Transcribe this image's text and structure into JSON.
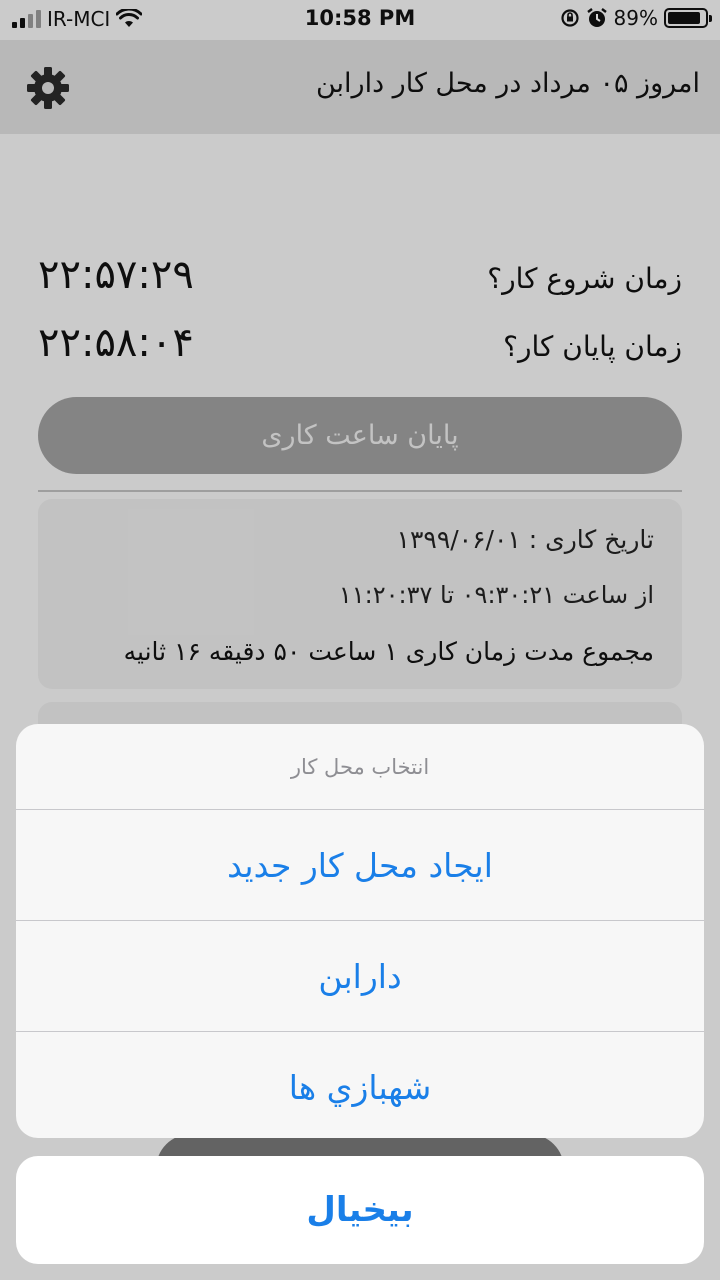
{
  "status_bar": {
    "carrier": "IR-MCI",
    "time": "10:58 PM",
    "battery": "89%",
    "battery_level": 0.89
  },
  "header": {
    "title": "امروز ۰۵ مرداد در محل کار دارابن",
    "settings_icon": "gear-icon"
  },
  "work_times": {
    "start_label": "زمان شروع کار؟",
    "start_value": "۲۲:۵۷:۲۹",
    "end_label": "زمان پایان کار؟",
    "end_value": "۲۲:۵۸:۰۴"
  },
  "end_button_label": "پایان ساعت کاری",
  "record": {
    "date": "تاریخ کاری : ۱۳۹۹/۰۶/۰۱",
    "range": "از ساعت ۰۹:۳۰:۲۱ تا ۱۱:۲۰:۳۷",
    "total": "مجموع مدت زمان کاری ۱ ساعت ۵۰ دقیقه ۱۶ ثانیه"
  },
  "action_sheet": {
    "title": "انتخاب محل کار",
    "options": [
      {
        "label": "ایجاد محل کار جدید"
      },
      {
        "label": "دارابن"
      },
      {
        "label": "شهبازي ها"
      }
    ],
    "cancel_label": "بیخیال"
  },
  "colors": {
    "accent": "#1a7fe8",
    "header_bg": "#dcdcdc",
    "button_bg": "#9e9e9e"
  }
}
